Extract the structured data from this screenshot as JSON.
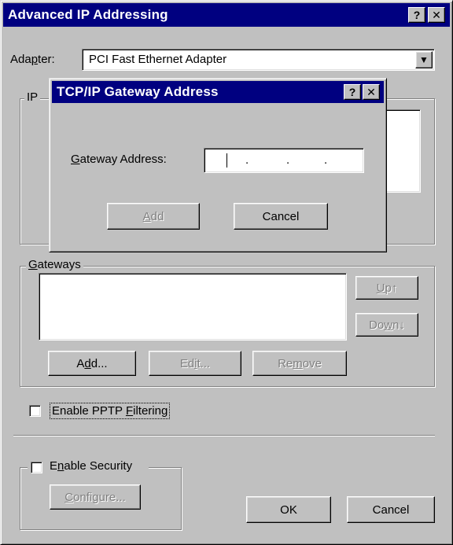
{
  "main_window": {
    "title": "Advanced IP Addressing",
    "help_btn": "?",
    "close_btn": "✕",
    "adapter": {
      "label_pre": "Ada",
      "label_mn": "p",
      "label_post": "ter:",
      "value": "PCI Fast Ethernet Adapter",
      "dropdown_arrow": "▼"
    },
    "ip_group_label": "IP",
    "gateways": {
      "label_mn": "G",
      "label_rest": "ateways",
      "up_mn": "U",
      "up_rest": "p↑",
      "down_pre": "Do",
      "down_mn": "w",
      "down_post": "n↓",
      "add_pre": "A",
      "add_mn": "d",
      "add_post": "d...",
      "edit_pre": "Ed",
      "edit_mn": "i",
      "edit_post": "t...",
      "remove_pre": "Re",
      "remove_mn": "m",
      "remove_post": "ove"
    },
    "pptp": {
      "label_pre": "Enable PPTP ",
      "label_mn": "F",
      "label_post": "iltering"
    },
    "security": {
      "label_pre": "E",
      "label_mn": "n",
      "label_post": "able Security",
      "configure_mn": "C",
      "configure_rest": "onfigure..."
    },
    "ok": "OK",
    "cancel": "Cancel"
  },
  "gateway_dialog": {
    "title": "TCP/IP Gateway Address",
    "help_btn": "?",
    "close_btn": "✕",
    "field_label_mn": "G",
    "field_label_rest": "ateway Address:",
    "ip_dots": [
      ".",
      ".",
      "."
    ],
    "add_mn": "A",
    "add_rest": "dd",
    "cancel": "Cancel"
  }
}
